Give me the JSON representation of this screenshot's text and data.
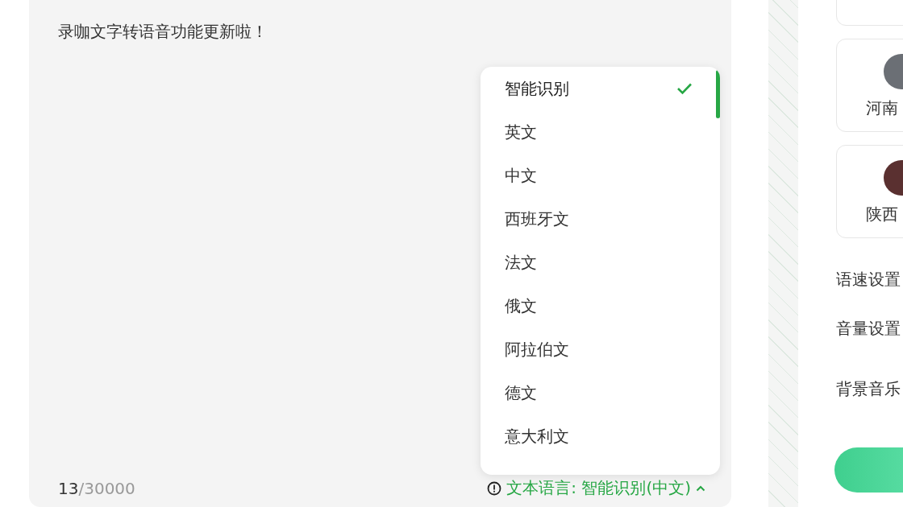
{
  "editor": {
    "text": "录咖文字转语音功能更新啦！",
    "count": "13",
    "limit": "/30000",
    "language_button": "文本语言: 智能识别(中文)",
    "expanded": true
  },
  "language_menu": [
    {
      "label": "智能识别",
      "selected": true
    },
    {
      "label": "英文",
      "selected": false
    },
    {
      "label": "中文",
      "selected": false
    },
    {
      "label": "西班牙文",
      "selected": false
    },
    {
      "label": "法文",
      "selected": false
    },
    {
      "label": "俄文",
      "selected": false
    },
    {
      "label": "阿拉伯文",
      "selected": false
    },
    {
      "label": "德文",
      "selected": false
    },
    {
      "label": "意大利文",
      "selected": false
    }
  ],
  "voices": [
    {
      "name": "河南"
    },
    {
      "name": "陕西"
    }
  ],
  "settings": [
    "语速设置",
    "音量设置",
    "背景音乐"
  ]
}
